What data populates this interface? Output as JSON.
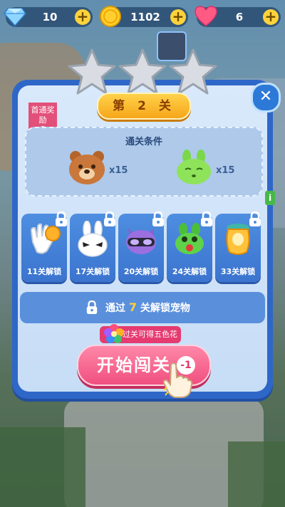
{
  "resources": {
    "gems": {
      "value": "10",
      "icon": "diamond-icon"
    },
    "coins": {
      "value": "1102",
      "icon": "coin-icon"
    },
    "lives": {
      "value": "6",
      "icon": "heart-icon"
    },
    "plus": "+"
  },
  "panel": {
    "stars": 3,
    "title": "第 2 关",
    "close": "✕",
    "first_badge": "首通奖励",
    "conditions_title": "通关条件",
    "goals": [
      {
        "icon": "bear-icon",
        "count": "x15"
      },
      {
        "icon": "green-rabbit-icon",
        "count": "x15"
      }
    ],
    "info": "i"
  },
  "pets": [
    {
      "icon": "glove-icon",
      "label": "11关解锁"
    },
    {
      "icon": "white-rabbit-icon",
      "label": "17关解锁"
    },
    {
      "icon": "purple-cat-icon",
      "label": "20关解锁"
    },
    {
      "icon": "frog-icon",
      "label": "24关解锁"
    },
    {
      "icon": "honey-jar-icon",
      "label": "33关解锁"
    }
  ],
  "unlock": {
    "prefix": "通过 ",
    "number": "7",
    "suffix": " 关解锁宠物"
  },
  "start": {
    "tip": "过关可得五色花",
    "label": "开始闯关",
    "cost": "-1"
  },
  "colors": {
    "panel": "#2f67c8",
    "start": "#f04f7f",
    "accent": "#ffd23a"
  }
}
